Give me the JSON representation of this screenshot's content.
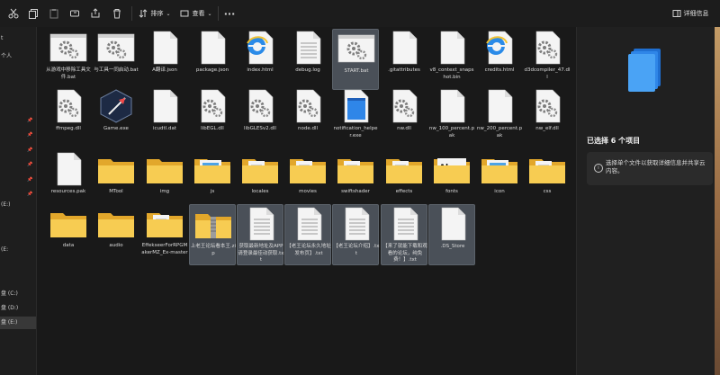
{
  "toolbar": {
    "sort_label": "排序",
    "view_label": "查看",
    "more_label": "···",
    "details_label": "详细信息",
    "icons": [
      "cut-icon",
      "copy-icon",
      "paste-icon",
      "rename-icon",
      "share-icon",
      "delete-icon",
      "sort-icon",
      "view-icon",
      "details-pane-icon"
    ]
  },
  "nav": {
    "items": [
      {
        "label": "t"
      },
      {
        "label": "个人"
      },
      {
        "label": ""
      },
      {
        "label": ""
      },
      {
        "label": ""
      },
      {
        "label": ""
      },
      {
        "label": ""
      },
      {
        "label": ""
      },
      {
        "label": ""
      },
      {
        "label": "(E:)"
      },
      {
        "label": ""
      },
      {
        "label": "(E:"
      },
      {
        "label": ""
      },
      {
        "label": ""
      },
      {
        "label": "盘 (C:)"
      },
      {
        "label": "盘 (D:)"
      },
      {
        "label": "盘 (E:)"
      }
    ]
  },
  "files": [
    {
      "name": "从游戏中移除工具文件.bat",
      "type": "bat",
      "selected": false
    },
    {
      "name": "与工具一同启动.bat",
      "type": "bat",
      "selected": false
    },
    {
      "name": "A翻译.json",
      "type": "doc",
      "selected": false
    },
    {
      "name": "package.json",
      "type": "doc",
      "selected": false
    },
    {
      "name": "index.html",
      "type": "edge",
      "selected": false
    },
    {
      "name": "debug.log",
      "type": "lines",
      "selected": false
    },
    {
      "name": "START.bat",
      "type": "bat",
      "selected": true
    },
    {
      "name": ".gitattributes",
      "type": "doc",
      "selected": false
    },
    {
      "name": "v8_context_snapshot.bin",
      "type": "doc",
      "selected": false
    },
    {
      "name": "credits.html",
      "type": "edge",
      "selected": false
    },
    {
      "name": "d3dcompiler_47.dll",
      "type": "gear",
      "selected": false
    },
    {
      "name": "ffmpeg.dll",
      "type": "gear",
      "selected": false
    },
    {
      "name": "Game.exe",
      "type": "exe",
      "selected": false
    },
    {
      "name": "icudtl.dat",
      "type": "doc",
      "selected": false
    },
    {
      "name": "libEGL.dll",
      "type": "gear",
      "selected": false
    },
    {
      "name": "libGLESv2.dll",
      "type": "gear",
      "selected": false
    },
    {
      "name": "node.dll",
      "type": "gear",
      "selected": false
    },
    {
      "name": "notification_helper.exe",
      "type": "app",
      "selected": false
    },
    {
      "name": "nw.dll",
      "type": "gear",
      "selected": false
    },
    {
      "name": "nw_100_percent.pak",
      "type": "doc",
      "selected": false
    },
    {
      "name": "nw_200_percent.pak",
      "type": "doc",
      "selected": false
    },
    {
      "name": "nw_elf.dll",
      "type": "gear",
      "selected": false
    },
    {
      "name": "resources.pak",
      "type": "doc",
      "selected": false
    },
    {
      "name": "MTool",
      "type": "folder",
      "selected": false
    },
    {
      "name": "img",
      "type": "folder",
      "selected": false
    },
    {
      "name": "js",
      "type": "folder-img",
      "selected": false
    },
    {
      "name": "locales",
      "type": "folder-doc",
      "selected": false
    },
    {
      "name": "movies",
      "type": "folder-doc",
      "selected": false
    },
    {
      "name": "swiftshader",
      "type": "folder-doc",
      "selected": false
    },
    {
      "name": "effects",
      "type": "folder-doc",
      "selected": false
    },
    {
      "name": "fonts",
      "type": "folder-font",
      "selected": false
    },
    {
      "name": "icon",
      "type": "folder-img",
      "selected": false
    },
    {
      "name": "css",
      "type": "folder-doc",
      "selected": false
    },
    {
      "name": "data",
      "type": "folder",
      "selected": false
    },
    {
      "name": "audio",
      "type": "folder",
      "selected": false
    },
    {
      "name": "EffekseerForRPGMakerMZ_Ex-master",
      "type": "folder-doc",
      "selected": false
    },
    {
      "name": "上老王论坛看本王.zip",
      "type": "zip",
      "selected": true
    },
    {
      "name": "获取最新地址及APP请登录最佳动获取.txt",
      "type": "lines",
      "selected": true
    },
    {
      "name": "【老王论坛永久地址发布页】.txt",
      "type": "lines",
      "selected": true
    },
    {
      "name": "【老王论坛介绍】.txt",
      "type": "lines",
      "selected": true
    },
    {
      "name": "【来了就能下载和观看的论坛，纯免费！】.txt",
      "type": "lines",
      "selected": true
    },
    {
      "name": ".DS_Store",
      "type": "doc",
      "selected": true
    }
  ],
  "details": {
    "selection_count": "已选择 6 个项目",
    "info_text": "选择单个文件以获取详细信息并共享云内容。"
  },
  "colors": {
    "background": "#191919",
    "selected": "#4a5058",
    "folder": "#f5c445",
    "accent": "#3b8ee8"
  }
}
